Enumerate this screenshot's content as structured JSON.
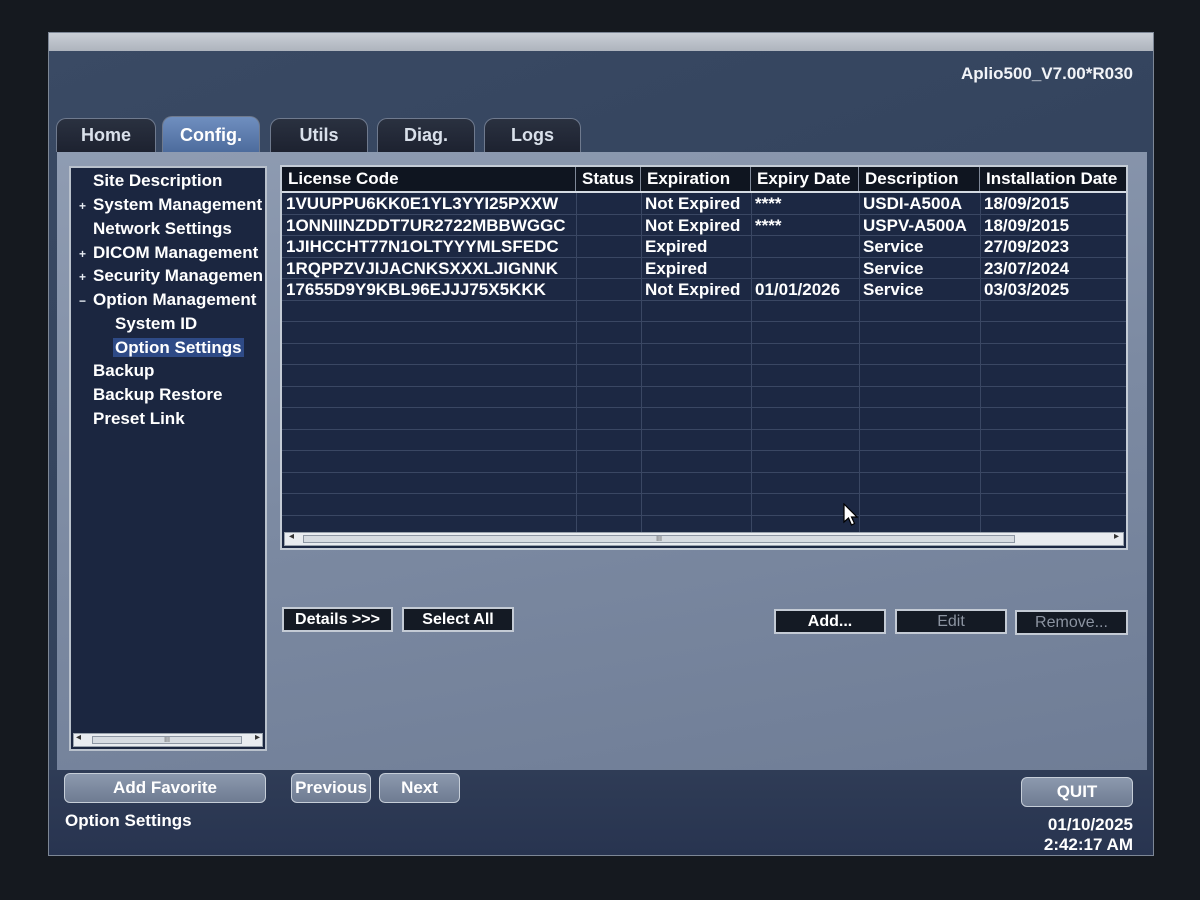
{
  "header": {
    "version": "Aplio500_V7.00*R030"
  },
  "tabs": [
    "Home",
    "Config.",
    "Utils",
    "Diag.",
    "Logs"
  ],
  "active_tab": "Config.",
  "tree": [
    {
      "label": "Site Description",
      "expander": ""
    },
    {
      "label": "System Management",
      "expander": "+"
    },
    {
      "label": "Network Settings",
      "expander": ""
    },
    {
      "label": "DICOM Management",
      "expander": "+"
    },
    {
      "label": "Security Managemen",
      "expander": "+"
    },
    {
      "label": "Option Management",
      "expander": "−"
    },
    {
      "label": "System ID",
      "expander": ""
    },
    {
      "label": "Option Settings",
      "expander": ""
    },
    {
      "label": "Backup",
      "expander": ""
    },
    {
      "label": "Backup Restore",
      "expander": ""
    },
    {
      "label": "Preset Link",
      "expander": ""
    }
  ],
  "table": {
    "columns": [
      "License Code",
      "Status",
      "Expiration",
      "Expiry Date",
      "Description",
      "Installation Date"
    ],
    "rows": [
      [
        "1VUUPPU6KK0E1YL3YYI25PXXW",
        "",
        "Not Expired",
        "****",
        "USDI-A500A",
        "18/09/2015"
      ],
      [
        "1ONNIINZDDT7UR2722MBBWGGC",
        "",
        "Not Expired",
        "****",
        "USPV-A500A",
        "18/09/2015"
      ],
      [
        "1JIHCCHT77N1OLTYYYMLSFEDC",
        "",
        "Expired",
        "",
        "Service",
        "27/09/2023"
      ],
      [
        "1RQPPZVJIJACNKSXXXLJIGNNK",
        "",
        "Expired",
        "",
        "Service",
        "23/07/2024"
      ],
      [
        "17655D9Y9KBL96EJJJ75X5KKK",
        "",
        "Not Expired",
        "01/01/2026",
        "Service",
        "03/03/2025"
      ]
    ]
  },
  "buttons": {
    "details": "Details >>>",
    "select_all": "Select All",
    "add": "Add...",
    "edit": "Edit",
    "remove": "Remove...",
    "add_favorite": "Add Favorite",
    "previous": "Previous",
    "next": "Next",
    "quit": "QUIT"
  },
  "scroll_thumb": "III",
  "status": {
    "label": "Option Settings",
    "date": "01/10/2025",
    "time": "2:42:17 AM"
  },
  "colors": {
    "panel": "#1c2843",
    "tab_active": "#5b7aab",
    "background": "#34445e"
  }
}
